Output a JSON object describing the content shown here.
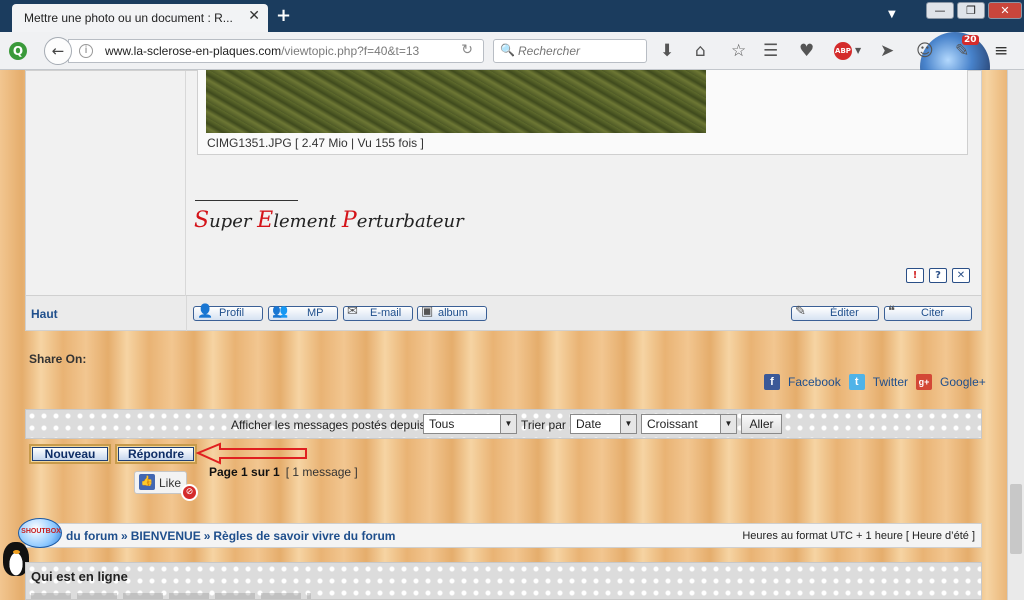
{
  "browser": {
    "tab_title": "Mettre une photo ou un document : R...",
    "tab_close": "✕",
    "new_tab": "+",
    "url_domain": "www.la-sclerose-en-plaques.com",
    "url_path": "/viewtopic.php?f=40&t=13",
    "search_placeholder": "Rechercher",
    "badge_count": "20",
    "abp_label": "ABP",
    "window_controls": [
      "—",
      "❐",
      "✕"
    ]
  },
  "post": {
    "attachment_caption": "CIMG1351.JPG [ 2.47 Mio | Vu 155 fois ]",
    "signature": [
      {
        "cap": "S",
        "rest": "uper "
      },
      {
        "cap": "E",
        "rest": "lement "
      },
      {
        "cap": "P",
        "rest": "erturbateur"
      }
    ],
    "top_actions": [
      "!",
      "?",
      "✕"
    ],
    "haut_label": "Haut",
    "buttons": {
      "profil": "Profil",
      "mp": "MP",
      "email": "E-mail",
      "album": "album",
      "editer": "Éditer",
      "citer": "Citer"
    }
  },
  "share": {
    "title": "Share On:",
    "facebook": "Facebook",
    "twitter": "Twitter",
    "google": "Google+"
  },
  "filter": {
    "label": "Afficher les messages postés depuis:",
    "since_value": "Tous",
    "sort_label": "Trier par",
    "sort_value": "Date",
    "order_value": "Croissant",
    "go_label": "Aller"
  },
  "actions": {
    "new_label": "Nouveau",
    "reply_label": "Répondre",
    "page_info": "Page 1 sur 1",
    "message_count": "[ 1 message ]",
    "like_label": "Like"
  },
  "breadcrumb": {
    "items": [
      "du forum",
      "BIENVENUE",
      "Règles de savoir vivre du forum"
    ],
    "separator": "»",
    "timezone": "Heures au format UTC + 1 heure [ Heure d’été ]"
  },
  "shoutbox_label": "SHOUTBOX",
  "online": {
    "title": "Qui est en ligne"
  },
  "colors": {
    "link_blue": "#1f4f8c",
    "signature_red": "#d4141a",
    "tabbar": "#1b3c5e"
  }
}
